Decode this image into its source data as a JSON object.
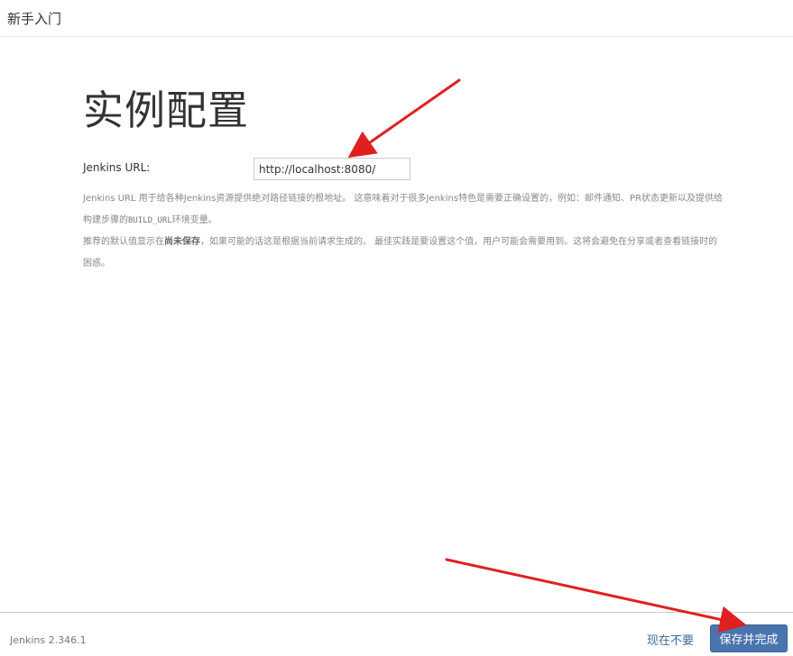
{
  "header": {
    "title": "新手入门"
  },
  "main": {
    "title": "实例配置",
    "url_label": "Jenkins URL:",
    "url_value": "http://localhost:8080/",
    "help": {
      "line1_part1": "Jenkins URL 用于给各种Jenkins资源提供绝对路径链接的根地址。 这意味着对于很多Jenkins特色是需要正确设置的，例如：邮件通知、PR状态更新以及提供给构建步骤的",
      "line1_code": "BUILD_URL",
      "line1_part2": "环境变量。",
      "line2_part1": "推荐的默认值显示在",
      "line2_strong": "尚未保存",
      "line2_part2": "，如果可能的话这是根据当前请求生成的。 最佳实践是要设置这个值，用户可能会需要用到。这将会避免在分享或者查看链接时的困惑。"
    }
  },
  "footer": {
    "version": "Jenkins 2.346.1",
    "skip_label": "现在不要",
    "save_label": "保存并完成"
  },
  "colors": {
    "accent": "#4a74ad",
    "link": "#3d6a9e",
    "annotation_arrow": "#e02020"
  }
}
